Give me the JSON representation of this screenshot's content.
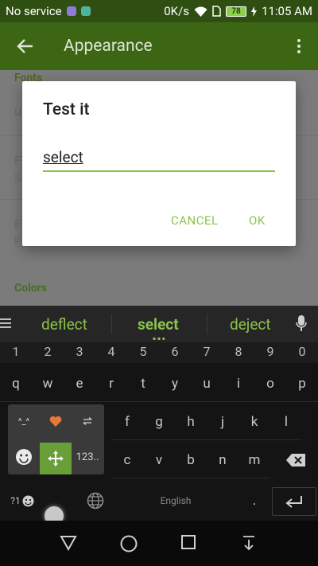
{
  "status_bar": {
    "carrier": "No service",
    "speed": "0K/s",
    "battery": "78",
    "time": "11:05 AM"
  },
  "app_bar": {
    "title": "Appearance"
  },
  "background": {
    "fonts_section": "Fonts",
    "item1_title": "u",
    "item2_title": "F",
    "item2_sub": "S",
    "item3_title": "F",
    "item3_sub": "P",
    "colors_section": "Colors"
  },
  "dialog": {
    "title": "Test it",
    "input_value": "select",
    "cancel": "CANCEL",
    "ok": "OK"
  },
  "keyboard": {
    "suggestions": [
      "deflect",
      "select",
      "deject"
    ],
    "numbers": [
      "1",
      "2",
      "3",
      "4",
      "5",
      "6",
      "7",
      "8",
      "9",
      "0"
    ],
    "row_q": [
      "q",
      "w",
      "e",
      "r",
      "t",
      "y",
      "u",
      "i",
      "o",
      "p"
    ],
    "row_a_visible": [
      "f",
      "g",
      "h",
      "j",
      "k",
      "l"
    ],
    "row_z_visible": [
      "c",
      "v",
      "b",
      "n",
      "m"
    ],
    "popup": {
      "emoticon": "^_^",
      "numbers_label": "123.."
    },
    "bottom": {
      "symbols": "?1",
      "space_label": "English",
      "period": "."
    }
  },
  "colors": {
    "accent": "#8bc34a",
    "app_bar": "#3c6514",
    "status_bar": "#2f4f12"
  }
}
